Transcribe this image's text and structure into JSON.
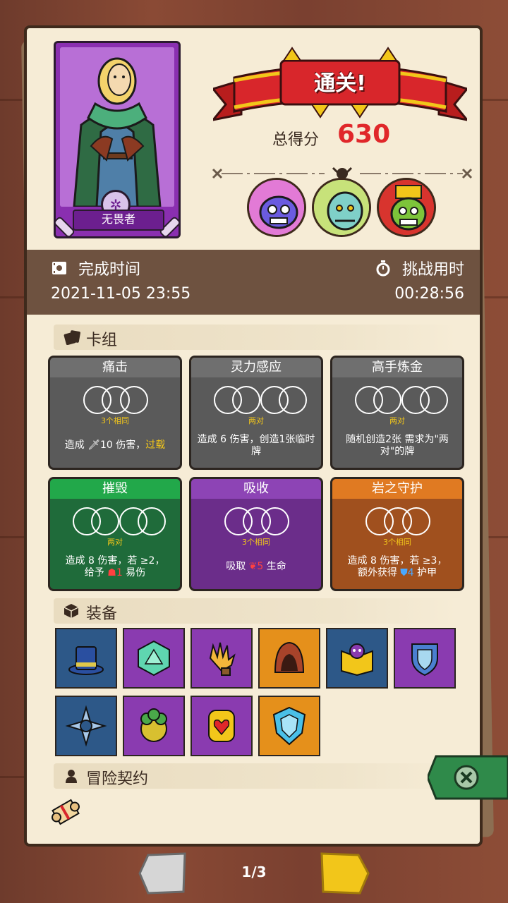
{
  "hero": {
    "name": "无畏者"
  },
  "result": {
    "title": "通关!",
    "score_label": "总得分",
    "score": "630"
  },
  "info": {
    "finish_label": "完成时间",
    "finish_value": "2021-11-05 23:55",
    "duration_label": "挑战用时",
    "duration_value": "00:28:56"
  },
  "deck": {
    "title": "卡组",
    "cards": [
      {
        "name": "痛击",
        "count": "3个相同",
        "desc_pre": "造成 ",
        "dmg": "10",
        "desc_mid": " 伤害，",
        "desc_hl": "过载"
      },
      {
        "name": "灵力感应",
        "count": "两对",
        "desc": "造成 6 伤害，创造1张临时牌"
      },
      {
        "name": "高手炼金",
        "count": "两对",
        "desc": "随机创造2张 需求为\"两对\"的牌"
      },
      {
        "name": "摧毁",
        "count": "两对",
        "line1": "造成 8 伤害，若 ≥2，",
        "line2_pre": "给予 ",
        "line2_num": "1",
        "line2_post": " 易伤"
      },
      {
        "name": "吸收",
        "count": "3个相同",
        "pre": "吸取 ",
        "num": "5",
        "post": " 生命"
      },
      {
        "name": "岩之守护",
        "count": "3个相同",
        "line1": "造成 8 伤害，若 ≥3，",
        "line2_pre": "额外获得 ",
        "line2_num": "4",
        "line2_post": " 护甲"
      }
    ]
  },
  "equipment": {
    "title": "装备",
    "items": [
      {
        "icon": "top-hat-icon",
        "color": "blue"
      },
      {
        "icon": "d20-dice-icon",
        "color": "purple"
      },
      {
        "icon": "glove-icon",
        "color": "purple"
      },
      {
        "icon": "hood-icon",
        "color": "orange"
      },
      {
        "icon": "skull-book-icon",
        "color": "blue"
      },
      {
        "icon": "blue-shield-icon",
        "color": "purple"
      },
      {
        "icon": "star-emblem-icon",
        "color": "blue"
      },
      {
        "icon": "bush-creature-icon",
        "color": "purple"
      },
      {
        "icon": "heart-gem-icon",
        "color": "purple"
      },
      {
        "icon": "ice-shield-icon",
        "color": "orange"
      }
    ]
  },
  "contract": {
    "title": "冒险契约"
  },
  "pager": {
    "text": "1/3"
  },
  "colors": {
    "gray": "#5a5a5a",
    "green": "#1f6b3a",
    "purple": "#6b2d8a",
    "orange": "#a0501e",
    "score": "#e0272a"
  }
}
